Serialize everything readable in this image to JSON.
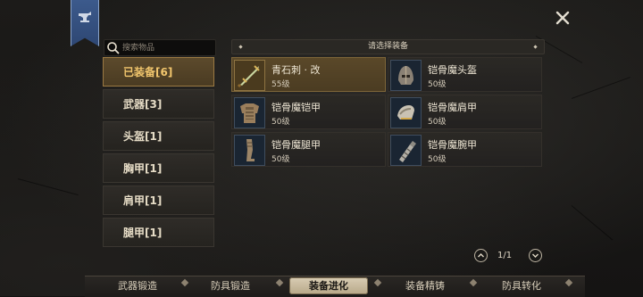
{
  "search": {
    "placeholder": "搜索物品",
    "value": ""
  },
  "categories": [
    {
      "label": "已装备[6]",
      "active": true
    },
    {
      "label": "武器[3]"
    },
    {
      "label": "头盔[1]"
    },
    {
      "label": "胸甲[1]"
    },
    {
      "label": "肩甲[1]"
    },
    {
      "label": "腿甲[1]"
    }
  ],
  "select_bar": {
    "title": "请选择装备"
  },
  "items": [
    {
      "name": "青石刺 · 改",
      "level": "55级",
      "icon": "dagger-icon",
      "selected": true
    },
    {
      "name": "铠骨魔头盔",
      "level": "50级",
      "icon": "helmet-icon"
    },
    {
      "name": "铠骨魔铠甲",
      "level": "50级",
      "icon": "chest-armor-icon"
    },
    {
      "name": "铠骨魔肩甲",
      "level": "50级",
      "icon": "shoulder-armor-icon"
    },
    {
      "name": "铠骨魔腿甲",
      "level": "50级",
      "icon": "leg-armor-icon"
    },
    {
      "name": "铠骨魔腕甲",
      "level": "50级",
      "icon": "bracer-icon"
    }
  ],
  "pager": {
    "text": "1/1"
  },
  "tabs": [
    {
      "label": "武器锻造"
    },
    {
      "label": "防具锻造"
    },
    {
      "label": "装备进化",
      "active": true
    },
    {
      "label": "装备精铸"
    },
    {
      "label": "防具转化"
    }
  ],
  "colors": {
    "accent": "#f2c66d",
    "banner": "#3c5a8c",
    "selected_item": "#5a4829"
  }
}
